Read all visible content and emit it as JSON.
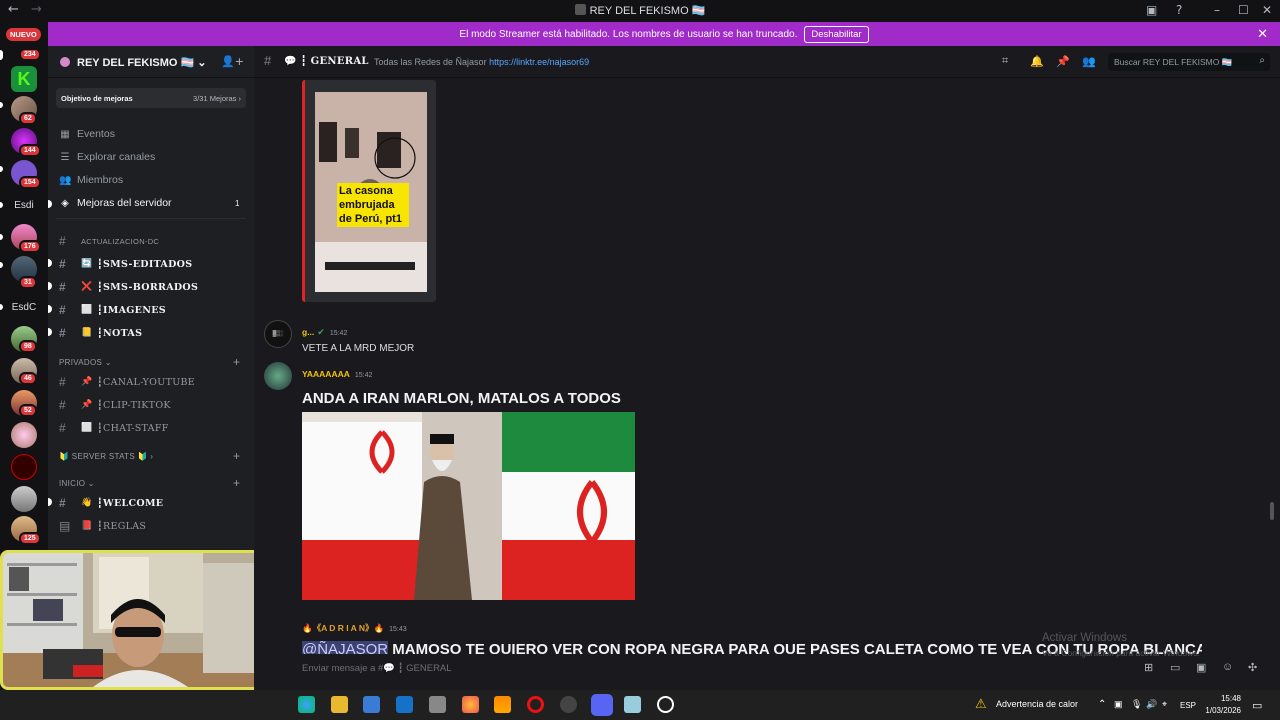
{
  "window": {
    "title": "REY DEL FEKISMO 🏳️‍⚧️",
    "back_icon": "←",
    "forward_icon": "→"
  },
  "banner": {
    "text": "El modo Streamer está habilitado. Los nombres de usuario se han truncado.",
    "button": "Deshabilitar",
    "color": "#a12bc9"
  },
  "rail": {
    "new_badge": "NUEVO",
    "badges": [
      "234",
      "62",
      "144",
      "154",
      "176",
      "31",
      "98",
      "46",
      "52",
      "125"
    ],
    "text_servers": [
      "Esdi",
      "EsdC"
    ]
  },
  "server": {
    "name": "REY DEL FEKISMO 🏳️‍⚧️",
    "goal_label": "Objetivo de mejoras",
    "goal_value": "3/31 Mejoras",
    "nav": [
      {
        "label": "Eventos",
        "icon": "calendar-icon",
        "glyph": "▦"
      },
      {
        "label": "Explorar canales",
        "icon": "browse-icon",
        "glyph": "☰"
      },
      {
        "label": "Miembros",
        "icon": "members-icon",
        "glyph": "👥"
      },
      {
        "label": "Mejoras del servidor",
        "icon": "boost-icon",
        "glyph": "◈",
        "count": "1"
      }
    ],
    "categories": {
      "actualizacion": "ACTUALIZACION-DC",
      "privados": "PRIVADOS",
      "server_stats": "🔰 SERVER STATS 🔰",
      "inicio": "INICIO"
    },
    "channels_top": [
      {
        "name": "┇SMS-EDITADOS",
        "emoji": "🔄"
      },
      {
        "name": "┇SMS-BORRADOS",
        "emoji": "❌"
      },
      {
        "name": "┇IMAGENES",
        "emoji": "⬜"
      },
      {
        "name": "┇NOTAS",
        "emoji": "📒"
      }
    ],
    "channels_priv": [
      {
        "name": "┇CANAL-YOUTUBE",
        "emoji": "📌"
      },
      {
        "name": "┇CLIP-TIKTOK",
        "emoji": "📌"
      },
      {
        "name": "┇CHAT-STAFF",
        "emoji": "⬜"
      }
    ],
    "channels_inicio": [
      {
        "name": "┇WELCOME",
        "emoji": "👋"
      },
      {
        "name": "┇REGLAS",
        "emoji": "📕"
      }
    ]
  },
  "channel": {
    "name": "GENERAL",
    "topic": "Todas las Redes de Ñajasor",
    "link": "https://linktr.ee/najasor69",
    "search_placeholder": "Buscar REY DEL FEKISMO 🏳️‍⚧️"
  },
  "messages": {
    "video_caption": "La casona embrujada de Perú, pt1",
    "m1": {
      "user": "g...",
      "time": "15:42",
      "text": "VETE A LA  MRD MEJOR"
    },
    "m2": {
      "user": "YAAAAAAA",
      "time": "15:42",
      "text": "ANDA A IRAN MARLON, MATALOS A TODOS"
    },
    "m3": {
      "user": "🔥《A D R I A N》🔥",
      "time": "15:43",
      "mention": "@ÑAJASOR",
      "text": " MAMOSO TE QUIERO VER CON ROPA NEGRA PARA QUE PASES CALETA COMO TE VEA CON TU ROPA BLANCA"
    }
  },
  "composer": {
    "placeholder": "Enviar mensaje a #💬 ┇ GENERAL"
  },
  "watermark": {
    "line1": "Activar Windows",
    "line2": "Ve a Configuración para activar Windows."
  },
  "taskbar": {
    "alert": "Advertencia de calor",
    "lang": "ESP",
    "time": "15:48",
    "date": "1/03/2026"
  }
}
